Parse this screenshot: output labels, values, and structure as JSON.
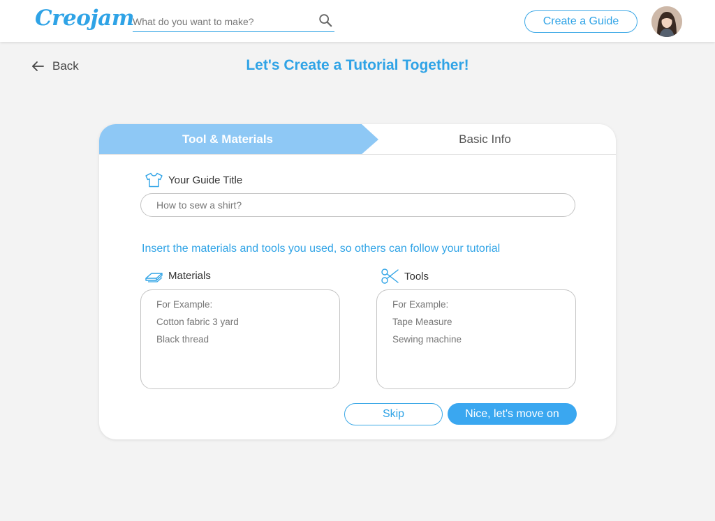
{
  "header": {
    "logo": "Creojam",
    "search_placeholder": "What do you want to make?",
    "create_button": "Create a Guide"
  },
  "nav": {
    "back_label": "Back"
  },
  "page": {
    "title": "Let's Create a Tutorial Together!"
  },
  "tabs": [
    {
      "label": "Tool & Materials",
      "active": true
    },
    {
      "label": "Basic Info",
      "active": false
    }
  ],
  "form": {
    "guide_title_label": "Your Guide Title",
    "guide_title_placeholder": "How to sew a shirt?",
    "instruction": "Insert the materials and tools you used, so others can follow your tutorial",
    "materials": {
      "label": "Materials",
      "lines": [
        "For Example:",
        "Cotton fabric 3 yard",
        "Black thread"
      ]
    },
    "tools": {
      "label": "Tools",
      "lines": [
        "For Example:",
        "Tape Measure",
        "Sewing machine"
      ]
    },
    "skip_button": "Skip",
    "next_button": "Nice, let's move on"
  },
  "colors": {
    "accent": "#2fa3e6",
    "tab_active": "#8ec8f5",
    "primary_button": "#3aa7f0",
    "background": "#f3f3f3"
  },
  "icons": [
    "search-icon",
    "back-arrow-icon",
    "shirt-icon",
    "fabric-icon",
    "scissors-icon"
  ]
}
